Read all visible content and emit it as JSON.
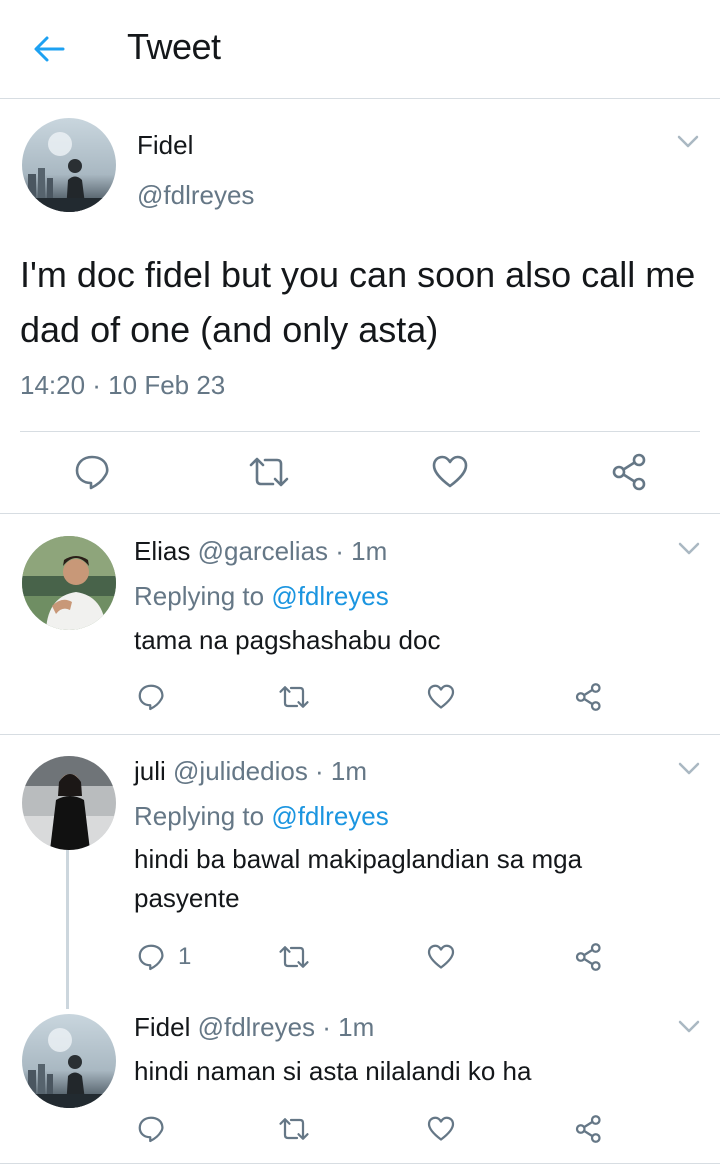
{
  "header": {
    "title": "Tweet",
    "back_icon": "arrow-left-icon",
    "accent": "#1da1f2"
  },
  "main_tweet": {
    "name": "Fidel",
    "handle": "@fdlreyes",
    "text": "I'm doc fidel but you can soon also call me dad of one (and only asta)",
    "timestamp": "14:20 · 10 Feb 23",
    "actions": [
      "reply-icon",
      "retweet-icon",
      "like-icon",
      "share-icon"
    ]
  },
  "replies": [
    {
      "name": "Elias",
      "meta": "@garcelias · 1m",
      "replying_prefix": "Replying to ",
      "replying_to": "@fdlreyes",
      "text": "tama na pagshashabu doc",
      "reply_count": ""
    },
    {
      "name": "juli",
      "meta": "@julidedios · 1m",
      "replying_prefix": "Replying to ",
      "replying_to": "@fdlreyes",
      "text": "hindi ba bawal makipaglandian sa mga pasyente",
      "reply_count": "1"
    },
    {
      "name": "Fidel",
      "meta": "@fdlreyes · 1m",
      "text": "hindi naman si asta nilalandi ko ha",
      "reply_count": ""
    }
  ],
  "colors": {
    "text": "#14171a",
    "secondary": "#657786",
    "link": "#1b95e0",
    "divider": "#d7dde2"
  }
}
